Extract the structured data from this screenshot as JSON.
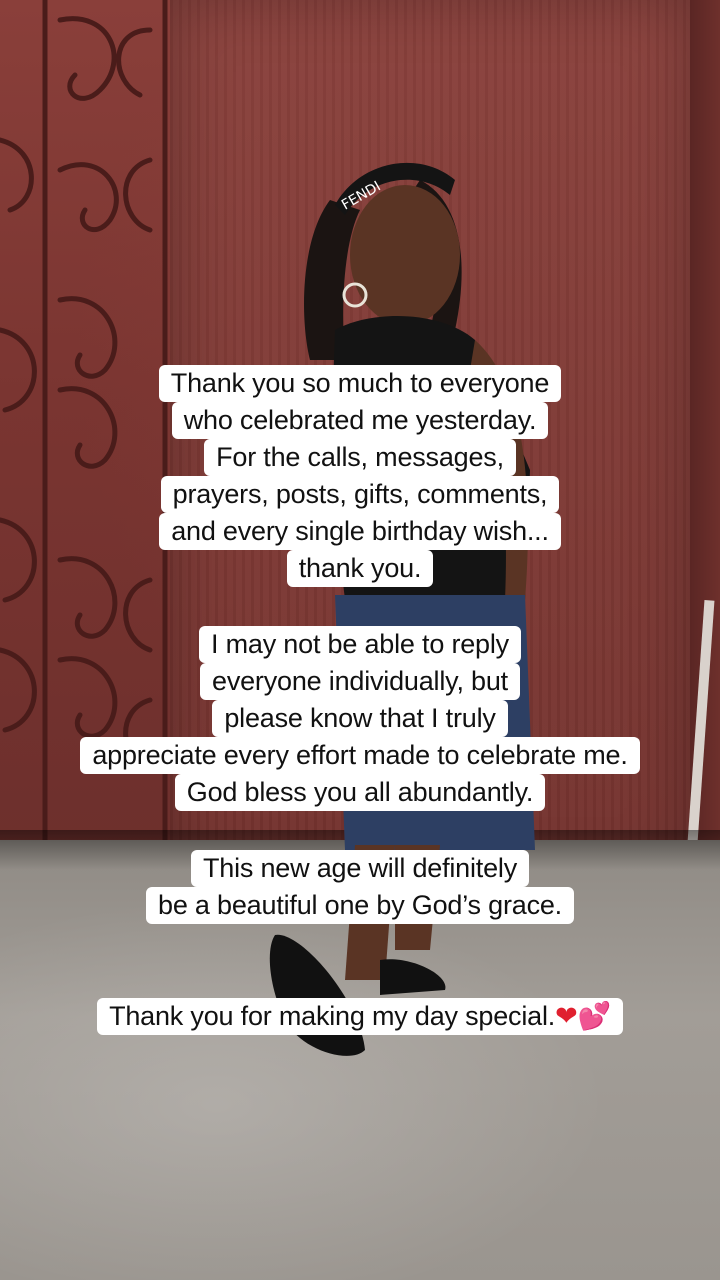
{
  "caption": {
    "paragraph_1": [
      "Thank you so much to everyone",
      "who celebrated me yesterday.",
      "For the calls, messages,",
      "prayers, posts, gifts, comments,",
      "and every single birthday wish...",
      "thank you."
    ],
    "paragraph_2": [
      "I may not be able to reply",
      "everyone individually, but",
      "please know that I truly",
      "appreciate every effort made to celebrate me.",
      "God bless you all abundantly."
    ],
    "paragraph_3": [
      "This new age will definitely",
      "be a beautiful one by God’s grace."
    ],
    "paragraph_4": {
      "text": "Thank you for making my day special.",
      "emoji_heart": "❤",
      "emoji_two_hearts": "💕"
    }
  },
  "photo": {
    "headband_text": "FENDI",
    "colors": {
      "gate": "#7b3733",
      "ground": "#9e9993",
      "shirt": "#141414",
      "skirt": "#2d3f63",
      "skin": "#5a3424"
    }
  }
}
